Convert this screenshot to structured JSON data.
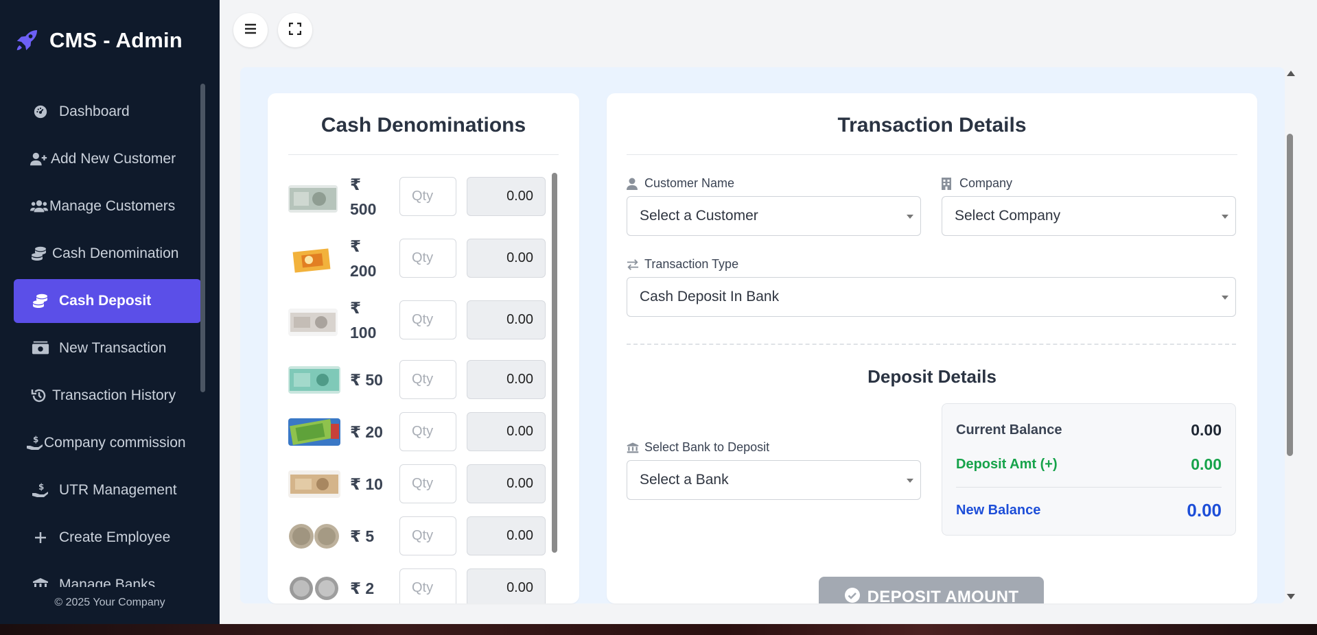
{
  "sidebar": {
    "brand": "CMS - Admin",
    "items": [
      {
        "label": "Dashboard",
        "icon": "gauge-icon"
      },
      {
        "label": "Add New Customer",
        "icon": "user-plus-icon"
      },
      {
        "label": "Manage Customers",
        "icon": "users-icon"
      },
      {
        "label": "Cash Denomination",
        "icon": "coins-icon"
      },
      {
        "label": "Cash Deposit",
        "icon": "coins-icon",
        "active": true
      },
      {
        "label": "New Transaction",
        "icon": "money-bill-icon"
      },
      {
        "label": "Transaction History",
        "icon": "history-icon"
      },
      {
        "label": "Company commission",
        "icon": "hand-holding-dollar-icon"
      },
      {
        "label": "UTR Management",
        "icon": "hand-holding-dollar-icon"
      },
      {
        "label": "Create Employee",
        "icon": "plus-icon"
      },
      {
        "label": "Manage Banks",
        "icon": "bank-icon"
      }
    ],
    "footer": "© 2025 Your Company"
  },
  "denominations": {
    "title": "Cash Denominations",
    "qty_placeholder": "Qty",
    "rows": [
      {
        "label": "₹ 500",
        "amount": "0.00"
      },
      {
        "label": "₹ 200",
        "amount": "0.00"
      },
      {
        "label": "₹ 100",
        "amount": "0.00"
      },
      {
        "label": "₹ 50",
        "amount": "0.00"
      },
      {
        "label": "₹ 20",
        "amount": "0.00"
      },
      {
        "label": "₹ 10",
        "amount": "0.00"
      },
      {
        "label": "₹ 5",
        "amount": "0.00"
      },
      {
        "label": "₹ 2",
        "amount": "0.00"
      }
    ]
  },
  "transaction": {
    "title": "Transaction Details",
    "customer_label": "Customer Name",
    "customer_value": "Select a Customer",
    "company_label": "Company",
    "company_value": "Select Company",
    "type_label": "Transaction Type",
    "type_value": "Cash Deposit In Bank",
    "deposit_title": "Deposit Details",
    "bank_label": "Select Bank to Deposit",
    "bank_value": "Select a Bank",
    "current_balance_label": "Current Balance",
    "current_balance": "0.00",
    "deposit_amt_label": "Deposit Amt (+)",
    "deposit_amt": "0.00",
    "new_balance_label": "New Balance",
    "new_balance": "0.00",
    "button": "DEPOSIT AMOUNT"
  },
  "colors": {
    "sidebar_bg": "#0f1a2b",
    "accent": "#5b4fe8",
    "deposit_green": "#16a34a",
    "new_balance_blue": "#1d4ed8"
  }
}
